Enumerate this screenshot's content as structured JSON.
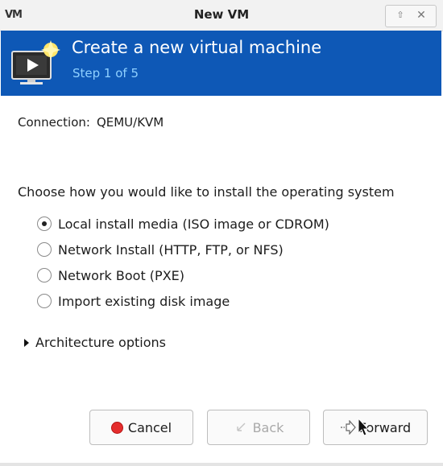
{
  "window": {
    "app_logo": "VM",
    "title": "New VM"
  },
  "header": {
    "title": "Create a new virtual machine",
    "step": "Step 1 of 5"
  },
  "connection": {
    "label": "Connection:",
    "value": "QEMU/KVM"
  },
  "install": {
    "prompt": "Choose how you would like to install the operating system",
    "options": [
      {
        "label": "Local install media (ISO image or CDROM)",
        "selected": true
      },
      {
        "label": "Network Install (HTTP, FTP, or NFS)",
        "selected": false
      },
      {
        "label": "Network Boot (PXE)",
        "selected": false
      },
      {
        "label": "Import existing disk image",
        "selected": false
      }
    ]
  },
  "architecture": {
    "label": "Architecture options",
    "expanded": false
  },
  "buttons": {
    "cancel": "Cancel",
    "back": "Back",
    "back_enabled": false,
    "forward": "Forward"
  },
  "colors": {
    "banner": "#0e58b6",
    "step_text": "#8fd0ff",
    "cancel_icon": "#e52d2d"
  }
}
